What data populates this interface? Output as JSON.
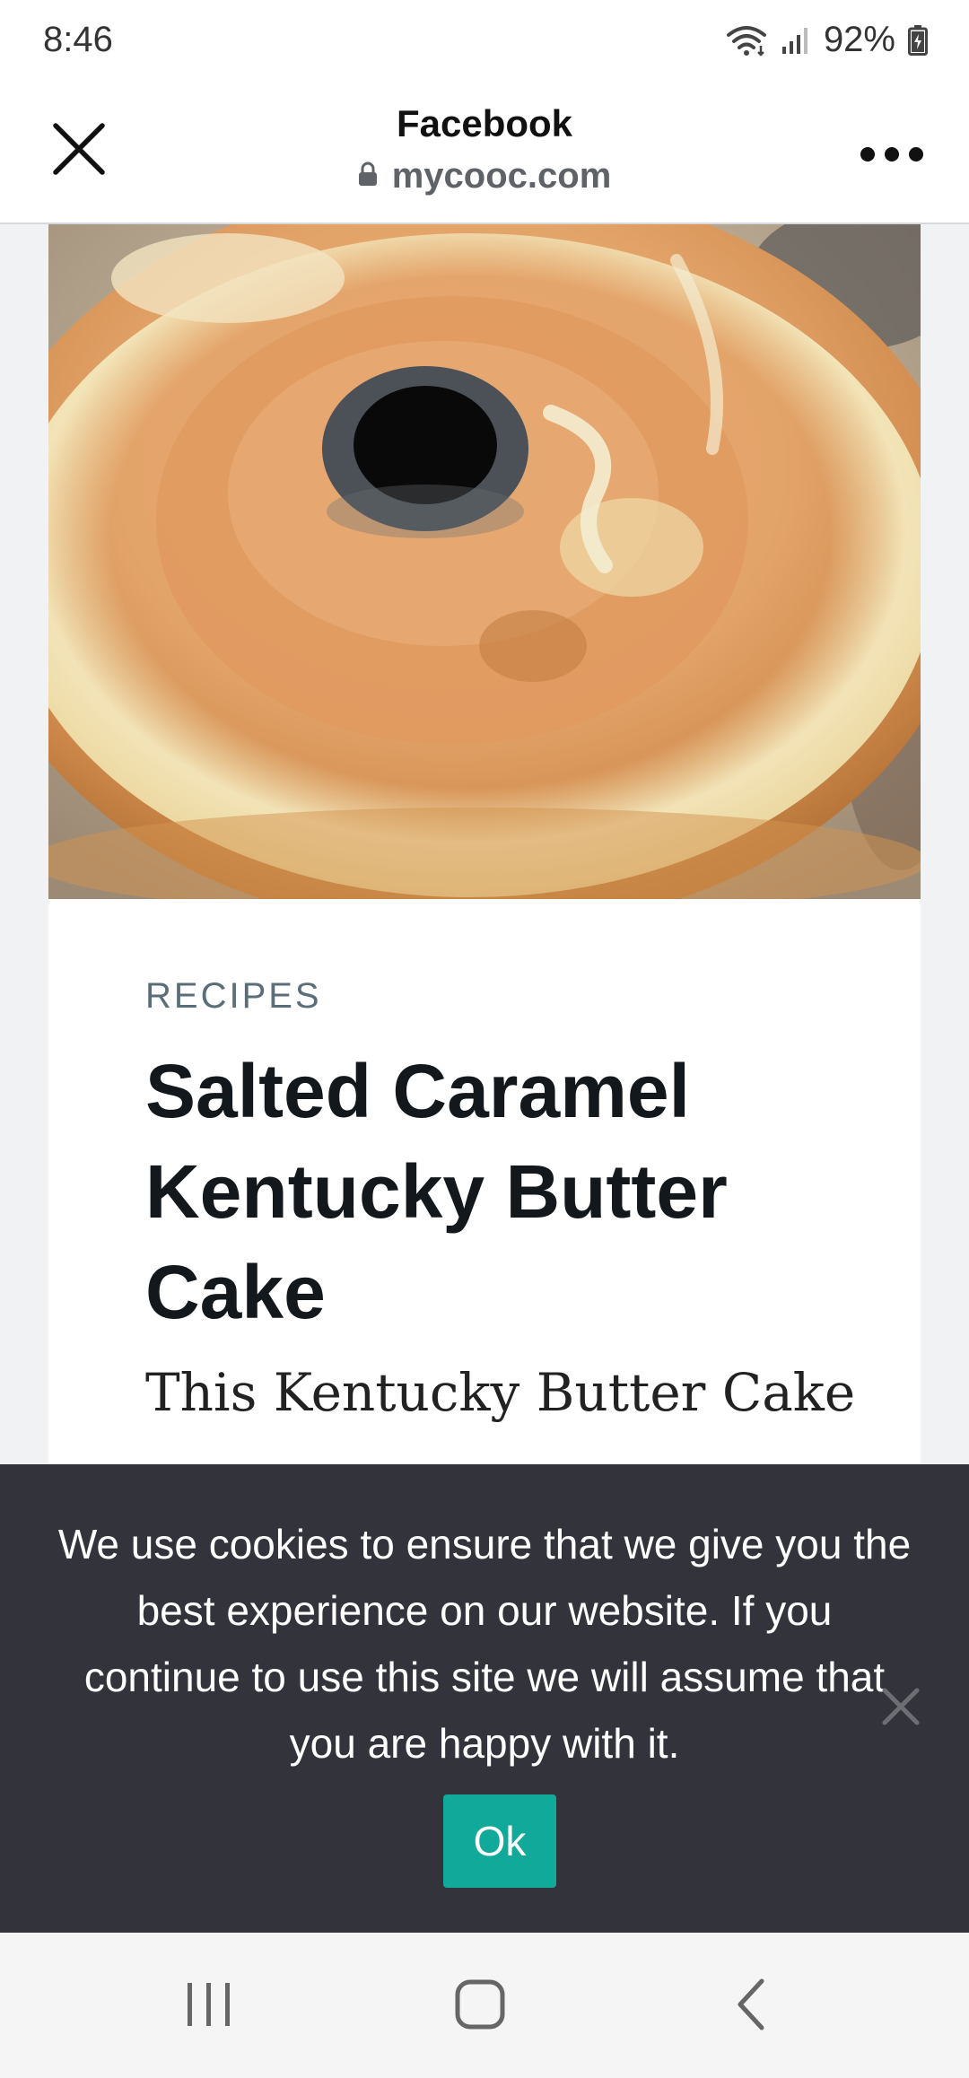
{
  "status_bar": {
    "time": "8:46",
    "battery": "92%",
    "icons": [
      "wifi-icon",
      "signal-icon",
      "battery-charging-icon"
    ]
  },
  "browser_header": {
    "title": "Facebook",
    "url": "mycooc.com",
    "icons": [
      "close-icon",
      "lock-icon",
      "more-options-icon"
    ]
  },
  "article": {
    "category": "RECIPES",
    "title": "Salted Caramel Kentucky Butter Cake",
    "excerpt": "This Kentucky Butter Cake"
  },
  "cookie_banner": {
    "message": "We use cookies to ensure that we give you the best experience on our website. If you continue to use this site we will assume that you are happy with it.",
    "ok_label": "Ok",
    "accent_color": "#10a99a"
  },
  "nav_bar": {
    "icons": [
      "recent-apps-icon",
      "home-icon",
      "back-icon"
    ]
  }
}
